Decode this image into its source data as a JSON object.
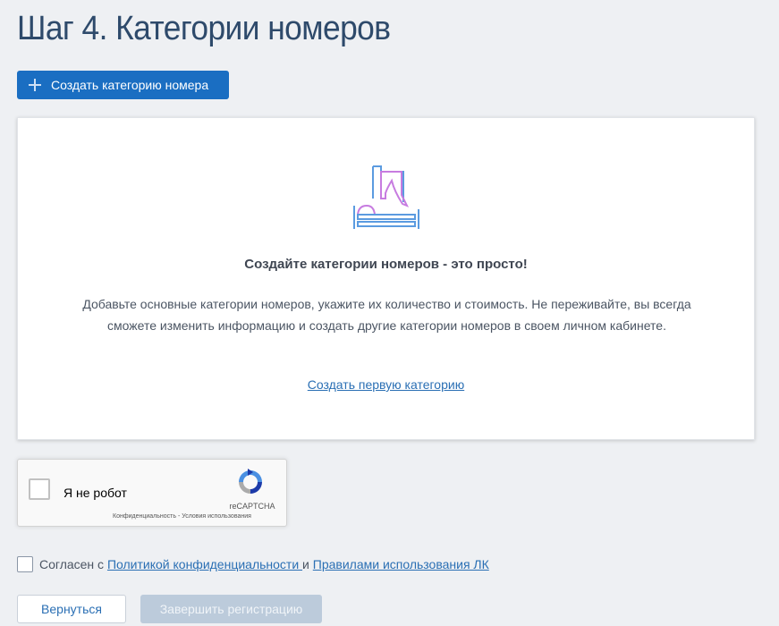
{
  "header": {
    "title": "Шаг 4. Категории номеров"
  },
  "toolbar": {
    "create_label": "Создать категорию номера",
    "create_icon": "plus-icon"
  },
  "empty_state": {
    "illustration": "hotel-room-icon",
    "heading": "Создайте категории номеров - это просто!",
    "text": "Добавьте основные категории номеров, укажите их количество и стоимость. Не переживайте, вы всегда сможете изменить информацию и создать другие категории номеров в своем личном кабинете.",
    "link": "Создать первую категорию"
  },
  "recaptcha": {
    "label": "Я не робот",
    "brand": "reCAPTCHA",
    "terms": "Конфиденциальность - Условия использования",
    "checked": false
  },
  "agreement": {
    "checked": false,
    "prefix": "Согласен с ",
    "privacy_link": "Политикой конфиденциальности ",
    "conjunction": "и ",
    "rules_link": "Правилами использования ЛК"
  },
  "footer": {
    "back_label": "Вернуться",
    "finish_label": "Завершить регистрацию"
  },
  "colors": {
    "primary": "#1a6ec2",
    "link": "#2a6fb4",
    "title": "#2e4a6b",
    "disabled": "#bccbdb",
    "illustration_blue": "#5b9be0",
    "illustration_purple": "#c77ce0"
  }
}
